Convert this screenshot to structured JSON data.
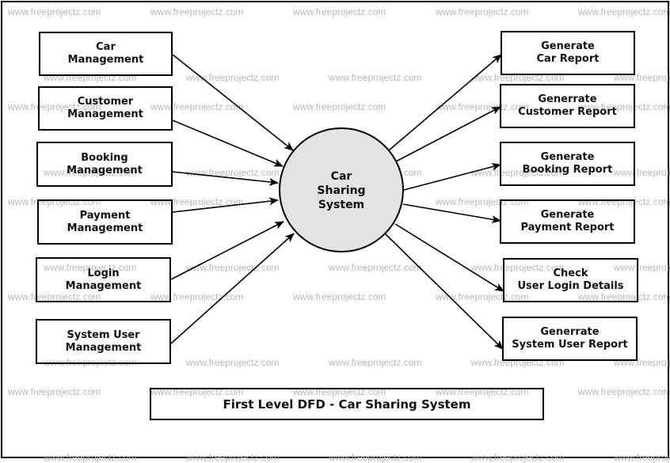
{
  "diagram": {
    "type": "first-level-dfd",
    "title": "First Level DFD - Car Sharing System",
    "watermark": "www.freeprojectz.com",
    "process": {
      "lines": [
        "Car",
        "Sharing",
        "System"
      ],
      "fill": "#e3e3e3"
    },
    "inputs": [
      {
        "lines": [
          "Car",
          "Management"
        ]
      },
      {
        "lines": [
          "Customer",
          "Management"
        ]
      },
      {
        "lines": [
          "Booking",
          "Management"
        ]
      },
      {
        "lines": [
          "Payment",
          "Management"
        ]
      },
      {
        "lines": [
          "Login",
          "Management"
        ]
      },
      {
        "lines": [
          "System User",
          "Management"
        ]
      }
    ],
    "outputs": [
      {
        "lines": [
          "Generate",
          "Car Report"
        ]
      },
      {
        "lines": [
          "Generrate",
          "Customer Report"
        ]
      },
      {
        "lines": [
          "Generate",
          "Booking Report"
        ]
      },
      {
        "lines": [
          "Generate",
          "Payment Report"
        ]
      },
      {
        "lines": [
          "Check",
          "User Login Details"
        ]
      },
      {
        "lines": [
          "Generrate",
          "System User Report"
        ]
      }
    ],
    "flows": [
      {
        "from": "Car Management",
        "to": "Car Sharing System"
      },
      {
        "from": "Customer Management",
        "to": "Car Sharing System"
      },
      {
        "from": "Booking Management",
        "to": "Car Sharing System"
      },
      {
        "from": "Payment Management",
        "to": "Car Sharing System"
      },
      {
        "from": "Login Management",
        "to": "Car Sharing System"
      },
      {
        "from": "System User Management",
        "to": "Car Sharing System"
      },
      {
        "from": "Car Sharing System",
        "to": "Generate Car Report"
      },
      {
        "from": "Car Sharing System",
        "to": "Generrate Customer Report"
      },
      {
        "from": "Car Sharing System",
        "to": "Generate Booking Report"
      },
      {
        "from": "Car Sharing System",
        "to": "Generate Payment Report"
      },
      {
        "from": "Car Sharing System",
        "to": "Check User Login Details"
      },
      {
        "from": "Car Sharing System",
        "to": "Generrate System User Report"
      }
    ]
  }
}
